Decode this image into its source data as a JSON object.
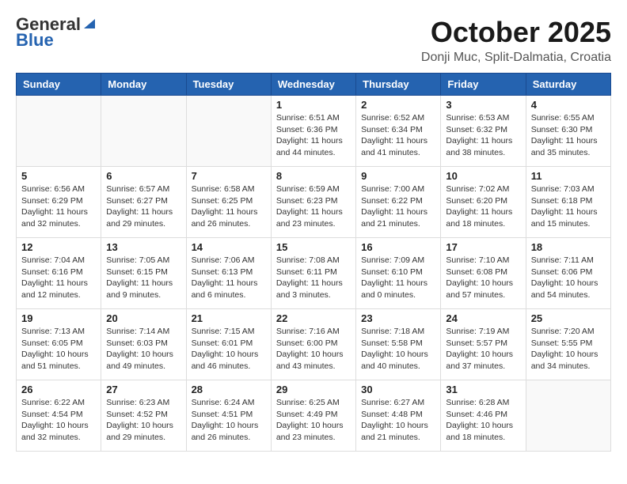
{
  "header": {
    "logo_general": "General",
    "logo_blue": "Blue",
    "title": "October 2025",
    "subtitle": "Donji Muc, Split-Dalmatia, Croatia"
  },
  "columns": [
    "Sunday",
    "Monday",
    "Tuesday",
    "Wednesday",
    "Thursday",
    "Friday",
    "Saturday"
  ],
  "weeks": [
    [
      {
        "day": "",
        "info": ""
      },
      {
        "day": "",
        "info": ""
      },
      {
        "day": "",
        "info": ""
      },
      {
        "day": "1",
        "info": "Sunrise: 6:51 AM\nSunset: 6:36 PM\nDaylight: 11 hours\nand 44 minutes."
      },
      {
        "day": "2",
        "info": "Sunrise: 6:52 AM\nSunset: 6:34 PM\nDaylight: 11 hours\nand 41 minutes."
      },
      {
        "day": "3",
        "info": "Sunrise: 6:53 AM\nSunset: 6:32 PM\nDaylight: 11 hours\nand 38 minutes."
      },
      {
        "day": "4",
        "info": "Sunrise: 6:55 AM\nSunset: 6:30 PM\nDaylight: 11 hours\nand 35 minutes."
      }
    ],
    [
      {
        "day": "5",
        "info": "Sunrise: 6:56 AM\nSunset: 6:29 PM\nDaylight: 11 hours\nand 32 minutes."
      },
      {
        "day": "6",
        "info": "Sunrise: 6:57 AM\nSunset: 6:27 PM\nDaylight: 11 hours\nand 29 minutes."
      },
      {
        "day": "7",
        "info": "Sunrise: 6:58 AM\nSunset: 6:25 PM\nDaylight: 11 hours\nand 26 minutes."
      },
      {
        "day": "8",
        "info": "Sunrise: 6:59 AM\nSunset: 6:23 PM\nDaylight: 11 hours\nand 23 minutes."
      },
      {
        "day": "9",
        "info": "Sunrise: 7:00 AM\nSunset: 6:22 PM\nDaylight: 11 hours\nand 21 minutes."
      },
      {
        "day": "10",
        "info": "Sunrise: 7:02 AM\nSunset: 6:20 PM\nDaylight: 11 hours\nand 18 minutes."
      },
      {
        "day": "11",
        "info": "Sunrise: 7:03 AM\nSunset: 6:18 PM\nDaylight: 11 hours\nand 15 minutes."
      }
    ],
    [
      {
        "day": "12",
        "info": "Sunrise: 7:04 AM\nSunset: 6:16 PM\nDaylight: 11 hours\nand 12 minutes."
      },
      {
        "day": "13",
        "info": "Sunrise: 7:05 AM\nSunset: 6:15 PM\nDaylight: 11 hours\nand 9 minutes."
      },
      {
        "day": "14",
        "info": "Sunrise: 7:06 AM\nSunset: 6:13 PM\nDaylight: 11 hours\nand 6 minutes."
      },
      {
        "day": "15",
        "info": "Sunrise: 7:08 AM\nSunset: 6:11 PM\nDaylight: 11 hours\nand 3 minutes."
      },
      {
        "day": "16",
        "info": "Sunrise: 7:09 AM\nSunset: 6:10 PM\nDaylight: 11 hours\nand 0 minutes."
      },
      {
        "day": "17",
        "info": "Sunrise: 7:10 AM\nSunset: 6:08 PM\nDaylight: 10 hours\nand 57 minutes."
      },
      {
        "day": "18",
        "info": "Sunrise: 7:11 AM\nSunset: 6:06 PM\nDaylight: 10 hours\nand 54 minutes."
      }
    ],
    [
      {
        "day": "19",
        "info": "Sunrise: 7:13 AM\nSunset: 6:05 PM\nDaylight: 10 hours\nand 51 minutes."
      },
      {
        "day": "20",
        "info": "Sunrise: 7:14 AM\nSunset: 6:03 PM\nDaylight: 10 hours\nand 49 minutes."
      },
      {
        "day": "21",
        "info": "Sunrise: 7:15 AM\nSunset: 6:01 PM\nDaylight: 10 hours\nand 46 minutes."
      },
      {
        "day": "22",
        "info": "Sunrise: 7:16 AM\nSunset: 6:00 PM\nDaylight: 10 hours\nand 43 minutes."
      },
      {
        "day": "23",
        "info": "Sunrise: 7:18 AM\nSunset: 5:58 PM\nDaylight: 10 hours\nand 40 minutes."
      },
      {
        "day": "24",
        "info": "Sunrise: 7:19 AM\nSunset: 5:57 PM\nDaylight: 10 hours\nand 37 minutes."
      },
      {
        "day": "25",
        "info": "Sunrise: 7:20 AM\nSunset: 5:55 PM\nDaylight: 10 hours\nand 34 minutes."
      }
    ],
    [
      {
        "day": "26",
        "info": "Sunrise: 6:22 AM\nSunset: 4:54 PM\nDaylight: 10 hours\nand 32 minutes."
      },
      {
        "day": "27",
        "info": "Sunrise: 6:23 AM\nSunset: 4:52 PM\nDaylight: 10 hours\nand 29 minutes."
      },
      {
        "day": "28",
        "info": "Sunrise: 6:24 AM\nSunset: 4:51 PM\nDaylight: 10 hours\nand 26 minutes."
      },
      {
        "day": "29",
        "info": "Sunrise: 6:25 AM\nSunset: 4:49 PM\nDaylight: 10 hours\nand 23 minutes."
      },
      {
        "day": "30",
        "info": "Sunrise: 6:27 AM\nSunset: 4:48 PM\nDaylight: 10 hours\nand 21 minutes."
      },
      {
        "day": "31",
        "info": "Sunrise: 6:28 AM\nSunset: 4:46 PM\nDaylight: 10 hours\nand 18 minutes."
      },
      {
        "day": "",
        "info": ""
      }
    ]
  ]
}
